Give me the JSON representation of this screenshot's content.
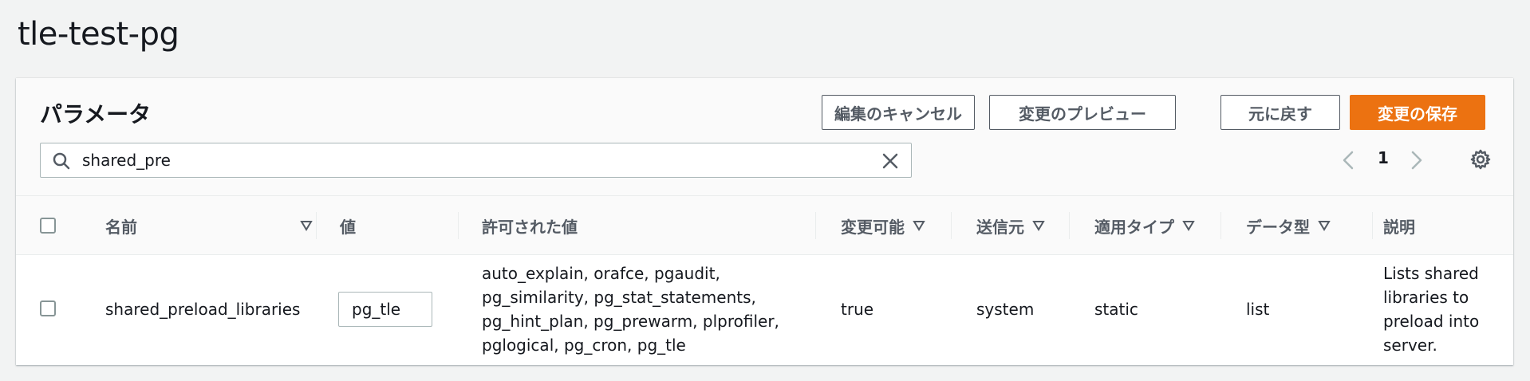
{
  "page": {
    "title": "tle-test-pg"
  },
  "panel": {
    "title": "パラメータ",
    "buttons": {
      "cancel_edit": "編集のキャンセル",
      "preview_changes": "変更のプレビュー",
      "reset": "元に戻す",
      "save_changes": "変更の保存"
    },
    "search": {
      "value": "shared_pre"
    },
    "pagination": {
      "current_page": "1"
    }
  },
  "table": {
    "columns": {
      "name": "名前",
      "value": "値",
      "allowed_values": "許可された値",
      "modifiable": "変更可能",
      "source": "送信元",
      "apply_type": "適用タイプ",
      "data_type": "データ型",
      "description": "説明"
    },
    "rows": [
      {
        "name": "shared_preload_libraries",
        "value": "pg_tle",
        "allowed_values": [
          "auto_explain, orafce, pgaudit,",
          "pg_similarity, pg_stat_statements,",
          "pg_hint_plan, pg_prewarm, plprofiler,",
          "pglogical, pg_cron, pg_tle"
        ],
        "modifiable": "true",
        "source": "system",
        "apply_type": "static",
        "data_type": "list",
        "description": [
          "Lists shared",
          "libraries to",
          "preload into",
          "server."
        ]
      }
    ]
  },
  "icons": {
    "search": "search-icon",
    "clear": "close-icon",
    "prev": "chevron-left-icon",
    "next": "chevron-right-icon",
    "settings": "gear-icon",
    "sort": "caret-down-icon"
  },
  "colors": {
    "primary": "#ec7211",
    "background": "#f2f3f3",
    "text": "#16191f",
    "secondary_text": "#545b64"
  }
}
